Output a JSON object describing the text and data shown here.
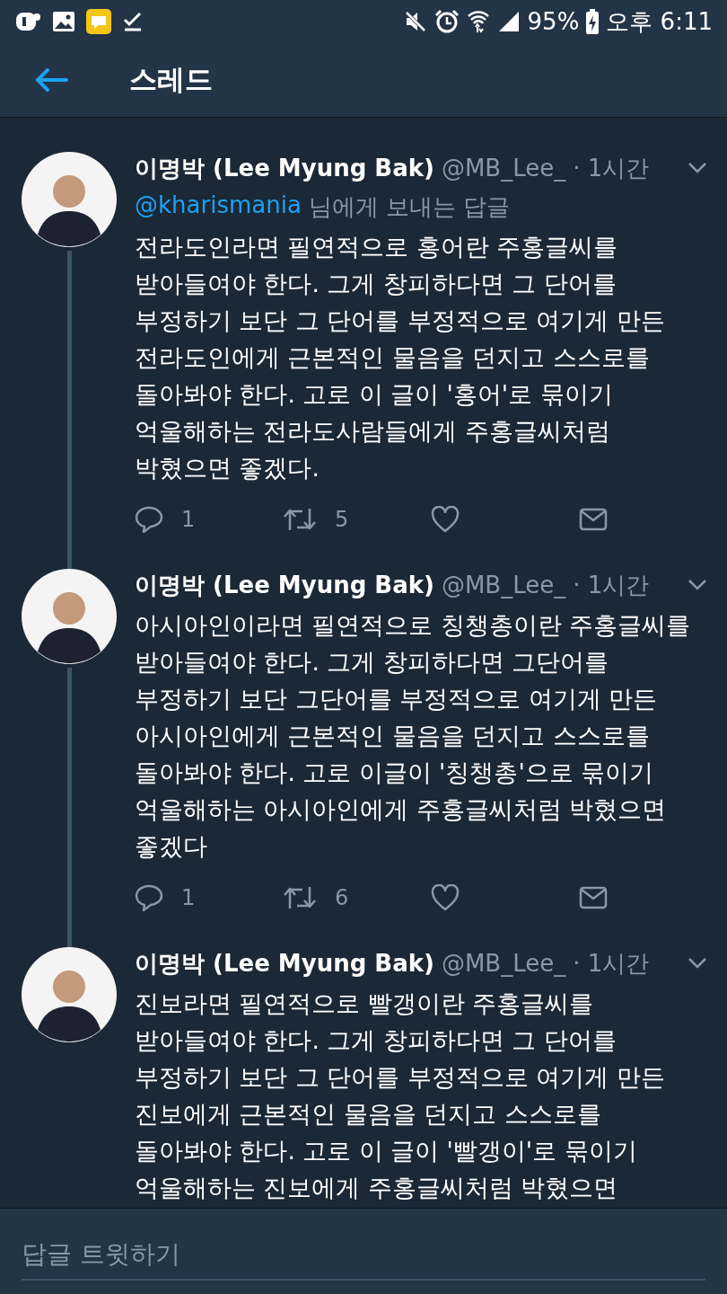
{
  "status_bar": {
    "battery": "95%",
    "time": "오후 6:11"
  },
  "header": {
    "title": "스레드"
  },
  "tweets": [
    {
      "name": "이명박 (Lee Myung Bak)",
      "handle": "@MB_Lee_",
      "time": "· 1시간",
      "reply_to": {
        "user": "@kharismania",
        "text": "님에게 보내는 답글"
      },
      "lines": [
        "전라도인라면 필연적으로 홍어란 주홍글씨를",
        "받아들여야 한다. 그게 창피하다면 그 단어를",
        "부정하기 보단 그 단어를 부정적으로 여기게 만든",
        "전라도인에게 근본적인 물음을 던지고 스스로를",
        "돌아봐야 한다. 고로 이 글이 '홍어'로 묶이기",
        "억울해하는 전라도사람들에게 주홍글씨처럼",
        "박혔으면 좋겠다."
      ],
      "replies": "1",
      "retweets": "5"
    },
    {
      "name": "이명박 (Lee Myung Bak)",
      "handle": "@MB_Lee_",
      "time": "· 1시간",
      "lines": [
        "아시아인이라면 필연적으로 칭챙총이란 주홍글씨를",
        "받아들여야 한다. 그게 창피하다면 그단어를",
        "부정하기 보단 그단어를 부정적으로 여기게 만든",
        "아시아인에게 근본적인 물음을 던지고 스스로를",
        "돌아봐야 한다. 고로 이글이 '칭챙총'으로 묶이기",
        "억울해하는 아시아인에게 주홍글씨처럼 박혔으면",
        "좋겠다"
      ],
      "replies": "1",
      "retweets": "6"
    },
    {
      "name": "이명박 (Lee Myung Bak)",
      "handle": "@MB_Lee_",
      "time": "· 1시간",
      "lines": [
        "진보라면 필연적으로 빨갱이란 주홍글씨를",
        "받아들여야 한다. 그게 창피하다면 그 단어를",
        "부정하기 보단 그 단어를 부정적으로 여기게 만든",
        "진보에게 근본적인 물음을 던지고 스스로를",
        "돌아봐야 한다. 고로 이 글이 '빨갱이'로 묶이기",
        "억울해하는 진보에게 주홍글씨처럼 박혔으면"
      ]
    }
  ],
  "reply_box": {
    "placeholder": "답글 트윗하기"
  }
}
